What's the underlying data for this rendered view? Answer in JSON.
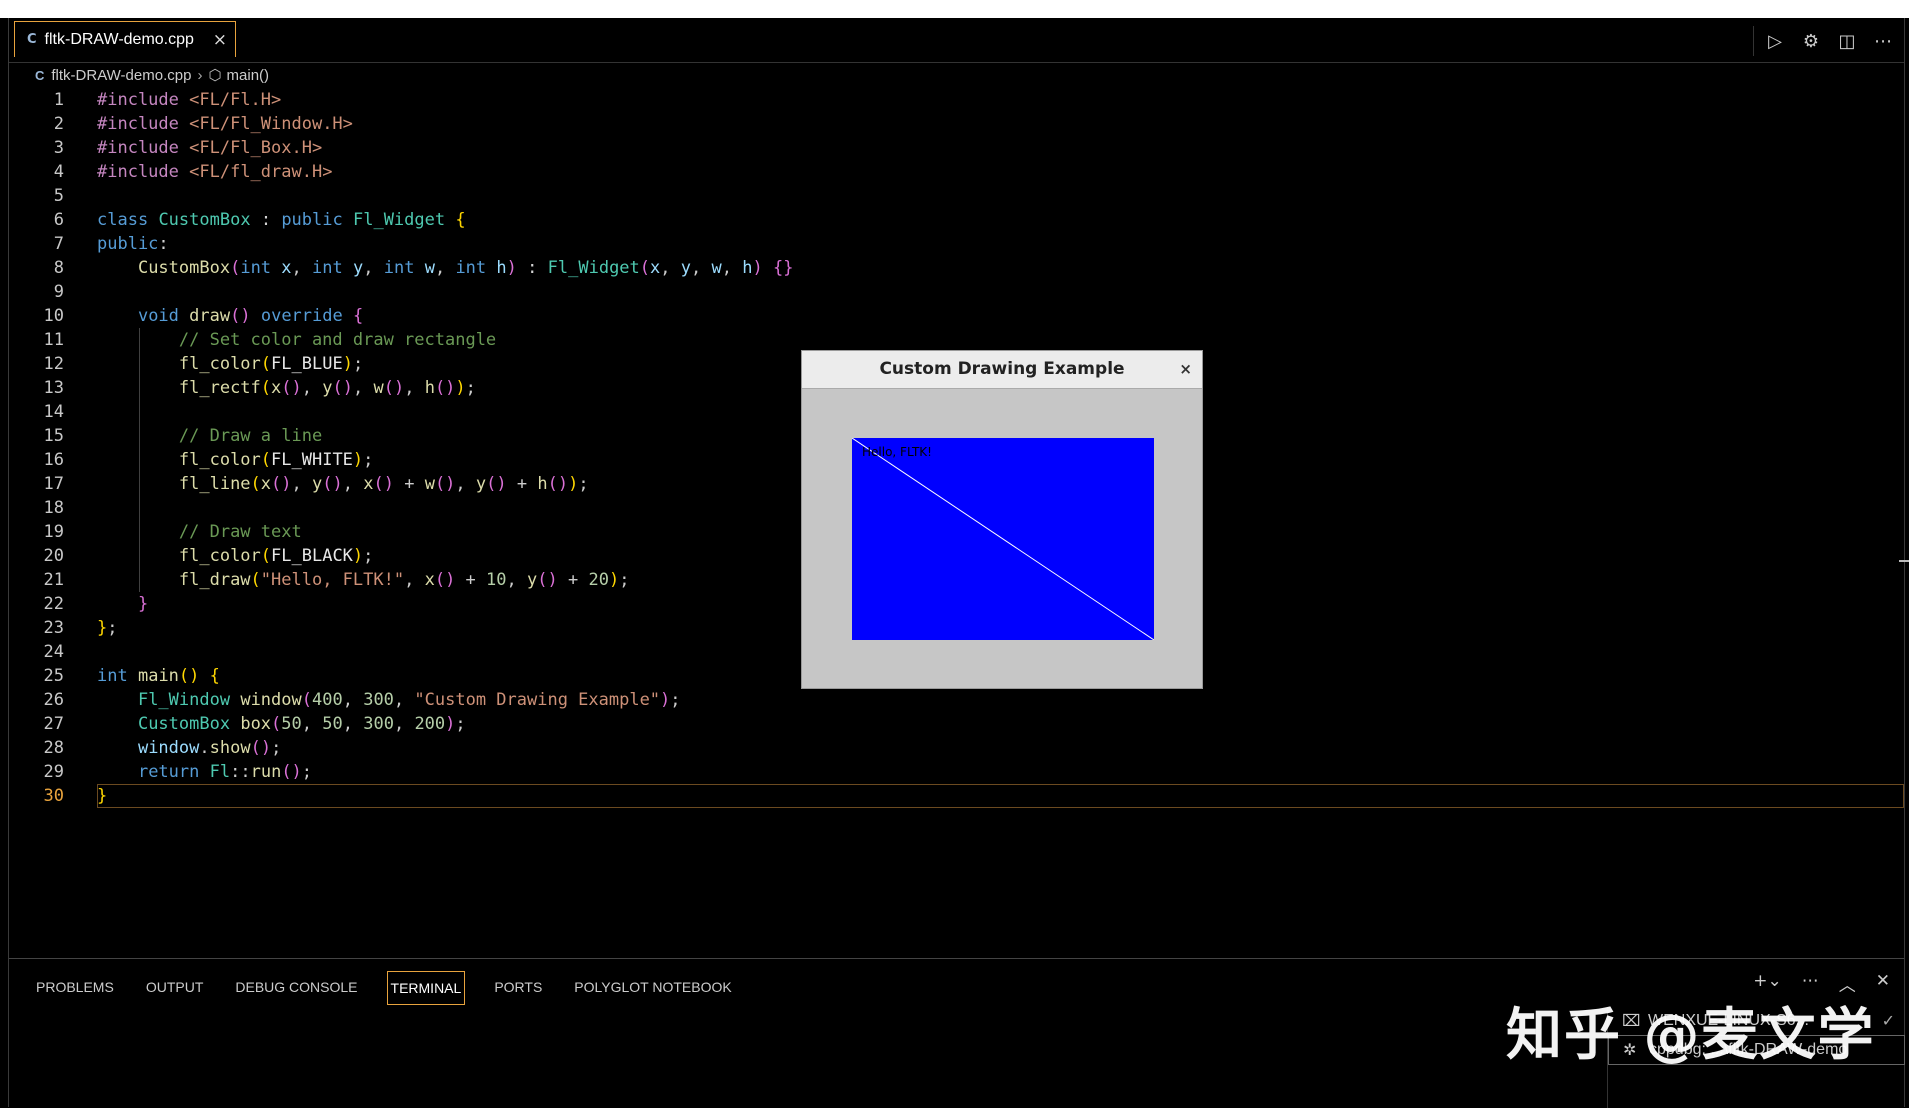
{
  "editor_tab": {
    "icon": "cpp-file-icon",
    "filename": "fltk-DRAW-demo.cpp",
    "close": "×"
  },
  "breadcrumb": {
    "file": "fltk-DRAW-demo.cpp",
    "symbol": "main()"
  },
  "editor": {
    "active_line": 30
  },
  "fltk_window": {
    "title": "Custom Drawing Example",
    "close": "×",
    "text": "Hello, FLTK!"
  },
  "panel": {
    "tabs": [
      {
        "label": "PROBLEMS"
      },
      {
        "label": "OUTPUT"
      },
      {
        "label": "DEBUG CONSOLE"
      },
      {
        "label": "TERMINAL"
      },
      {
        "label": "PORTS"
      },
      {
        "label": "POLYGLOT NOTEBOOK"
      }
    ],
    "active_tab": "TERMINAL",
    "terminals": [
      {
        "label": "WENXUE-LINUX-S6...",
        "icon": "terminal-icon"
      },
      {
        "label": "cppdbg: ...\\fltk-DRAW-demo",
        "icon": "debug-icon"
      }
    ]
  },
  "watermark": "知乎 @麦文学",
  "colors": {
    "accent": "#e8a33d",
    "canvas": "#0000ff"
  }
}
